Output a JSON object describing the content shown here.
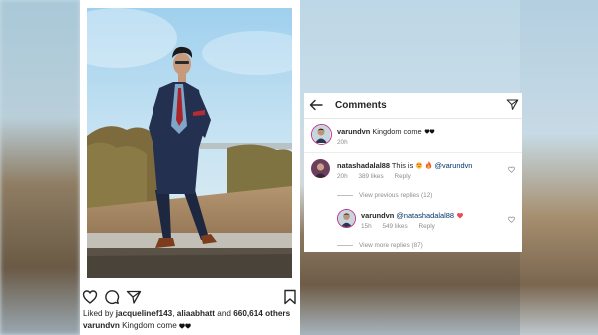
{
  "post": {
    "liked_by_prefix": "Liked by",
    "liked_by_user1": "jacquelinef143",
    "liked_by_sep": ",",
    "liked_by_user2": "aliaabhatt",
    "liked_by_and": "and",
    "liked_by_count": "660,614 others",
    "caption_user": "varundvn",
    "caption_text": "Kingdom come"
  },
  "comments_panel": {
    "title": "Comments",
    "original": {
      "username": "varundvn",
      "text": "Kingdom come",
      "time": "20h"
    },
    "comment1": {
      "username": "natashadalal88",
      "text_prefix": "This is",
      "mention": "@varundvn",
      "time": "20h",
      "likes": "389 likes",
      "reply": "Reply"
    },
    "view_previous": "View previous replies (12)",
    "reply1": {
      "username": "varundvn",
      "mention": "@natashadalal88",
      "time": "15h",
      "likes": "549 likes",
      "reply": "Reply"
    },
    "view_more": "View more replies (87)"
  },
  "icons": [
    "heart-icon",
    "comment-icon",
    "share-icon",
    "bookmark-icon",
    "back-arrow-icon",
    "send-icon"
  ],
  "colors": {
    "link": "#003569",
    "text": "#262626",
    "muted": "#8e8e8e",
    "heart_red": "#ed4956"
  }
}
